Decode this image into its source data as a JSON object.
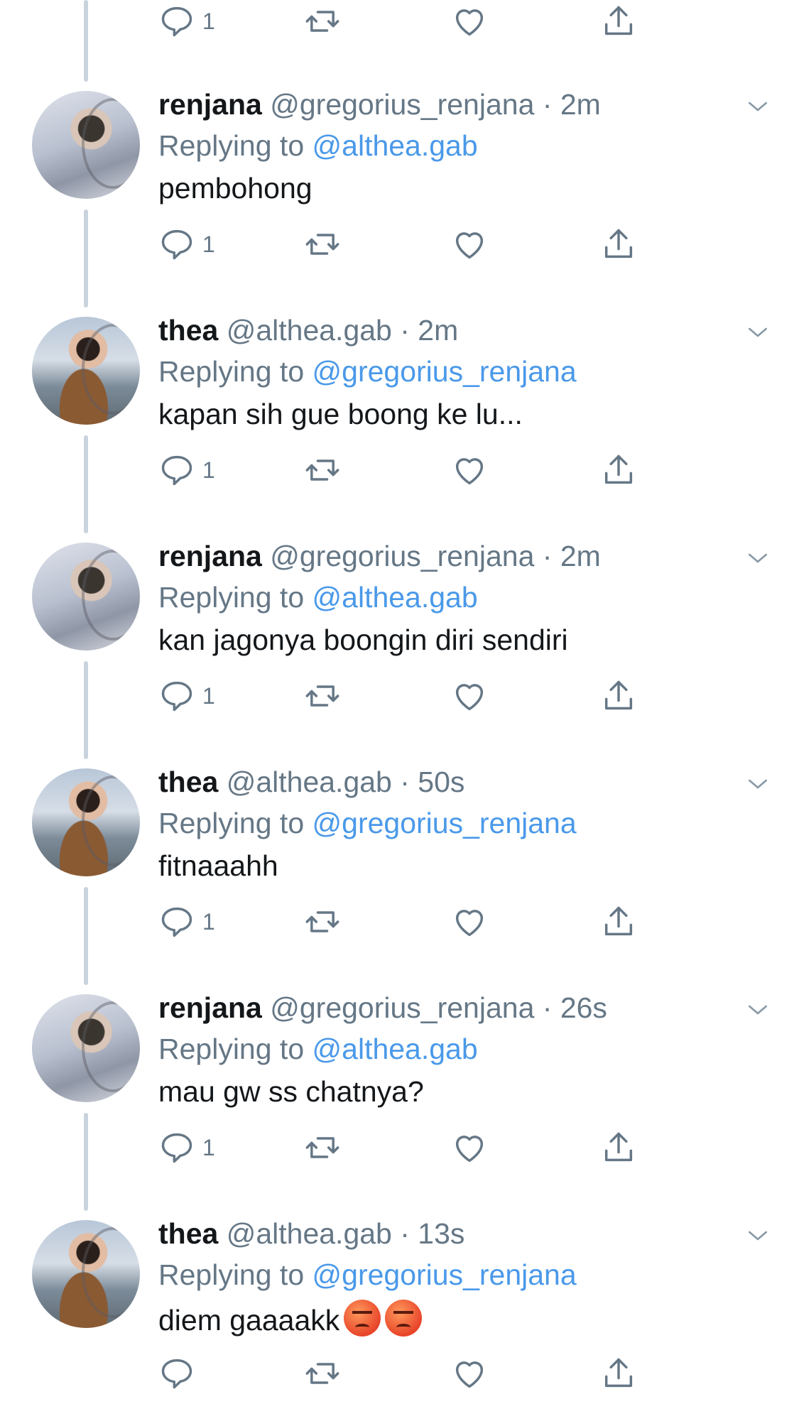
{
  "colors": {
    "mention": "#4a99e9",
    "secondary_text": "#657786",
    "primary_text": "#14171a",
    "thread_line": "#c9d3dd"
  },
  "top_actions": {
    "reply_count": "1"
  },
  "tweets": [
    {
      "name": "renjana",
      "handle": "@gregorius_renjana",
      "time": "· 2m",
      "replying_prefix": "Replying to",
      "replying_to": "@althea.gab",
      "text": "pembohong",
      "reply_count": "1",
      "avatar": "renjana"
    },
    {
      "name": "thea",
      "handle": "@althea.gab",
      "time": "· 2m",
      "replying_prefix": "Replying to",
      "replying_to": "@gregorius_renjana",
      "text": "kapan sih gue boong ke lu...",
      "reply_count": "1",
      "avatar": "thea"
    },
    {
      "name": "renjana",
      "handle": "@gregorius_renjana",
      "time": "· 2m",
      "replying_prefix": "Replying to",
      "replying_to": "@althea.gab",
      "text": "kan jagonya boongin diri sendiri",
      "reply_count": "1",
      "avatar": "renjana"
    },
    {
      "name": "thea",
      "handle": "@althea.gab",
      "time": "· 50s",
      "replying_prefix": "Replying to",
      "replying_to": "@gregorius_renjana",
      "text": "fitnaaahh",
      "reply_count": "1",
      "avatar": "thea"
    },
    {
      "name": "renjana",
      "handle": "@gregorius_renjana",
      "time": "· 26s",
      "replying_prefix": "Replying to",
      "replying_to": "@althea.gab",
      "text": "mau gw ss chatnya?",
      "reply_count": "1",
      "avatar": "renjana"
    },
    {
      "name": "thea",
      "handle": "@althea.gab",
      "time": "· 13s",
      "replying_prefix": "Replying to",
      "replying_to": "@gregorius_renjana",
      "text": "diem gaaaakk",
      "reply_count": "",
      "avatar": "thea",
      "emoji": [
        "pouting-face-emoji",
        "pouting-face-emoji"
      ]
    }
  ]
}
